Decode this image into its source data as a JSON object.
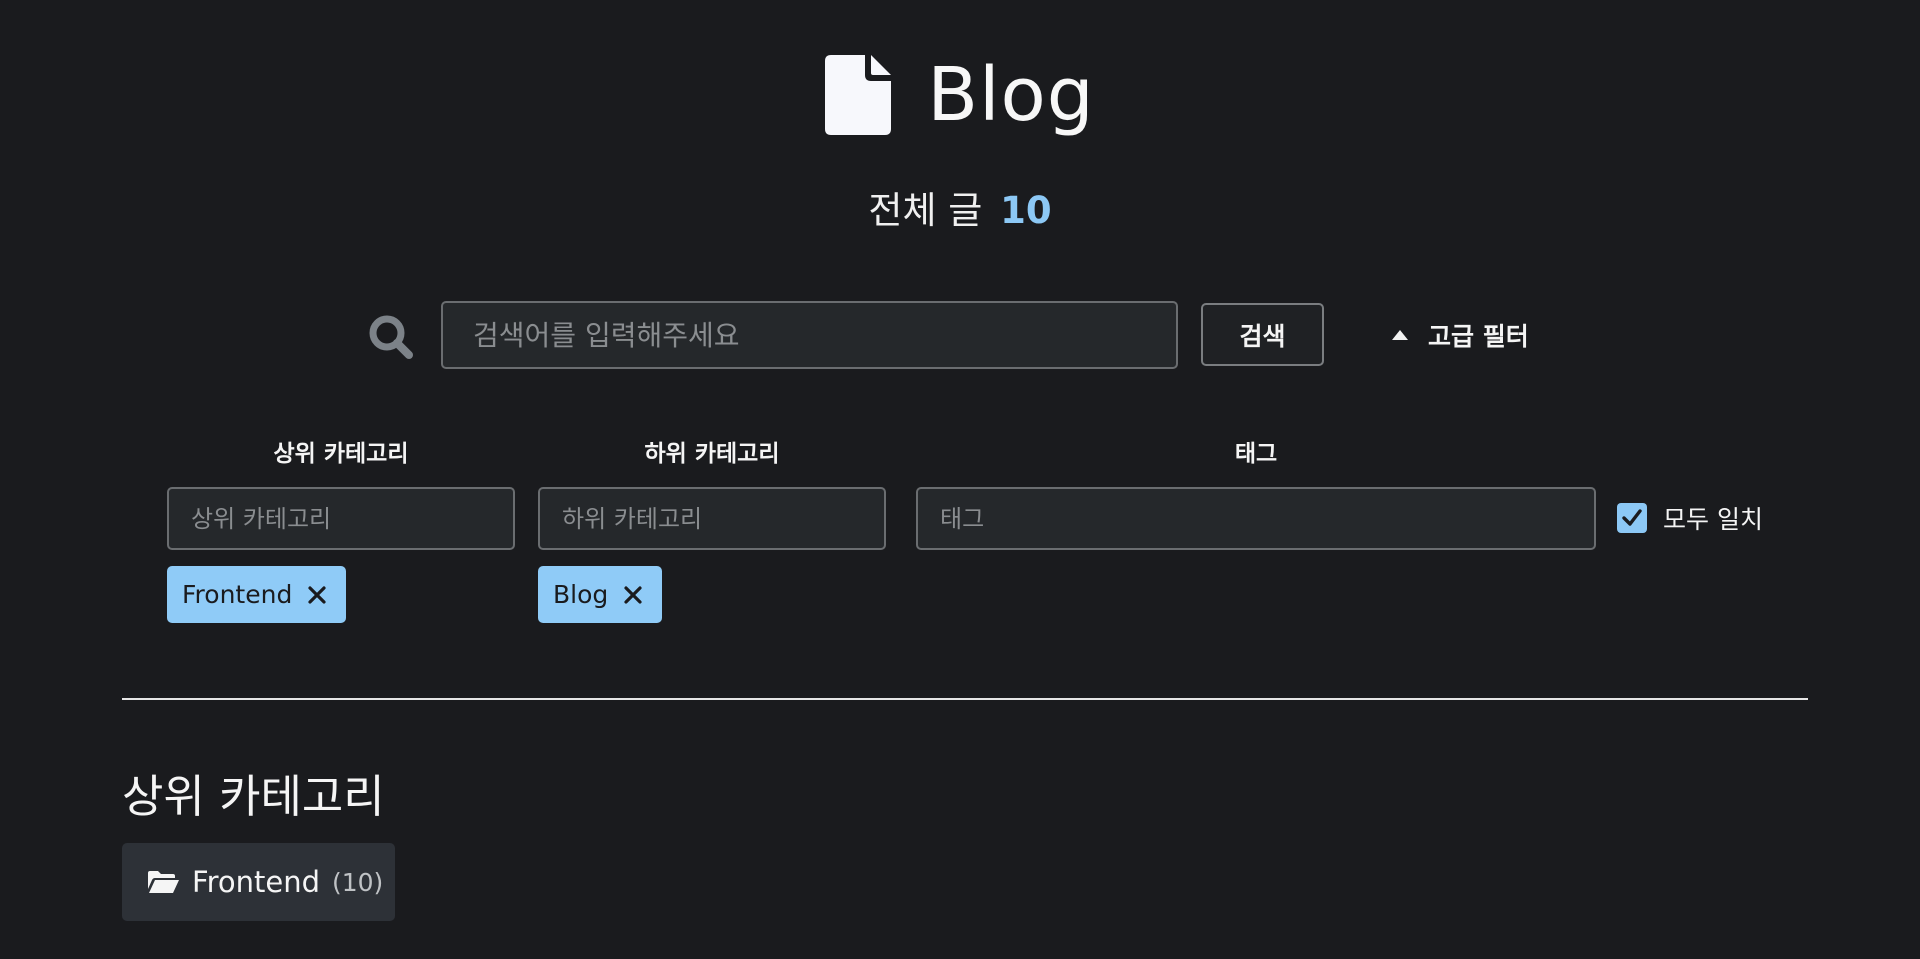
{
  "header": {
    "title": "Blog",
    "total_label": "전체 글",
    "total_count": "10",
    "icon": "document-icon"
  },
  "search": {
    "placeholder": "검색어를 입력해주세요",
    "value": "",
    "button_label": "검색",
    "advanced_label": "고급 필터",
    "advanced_expanded": true
  },
  "filters": {
    "parent_category": {
      "label": "상위 카테고리",
      "placeholder": "상위 카테고리",
      "chips": [
        "Frontend"
      ]
    },
    "child_category": {
      "label": "하위 카테고리",
      "placeholder": "하위 카테고리",
      "chips": [
        "Blog"
      ]
    },
    "tag": {
      "label": "태그",
      "placeholder": "태그",
      "chips": []
    },
    "match_all": {
      "label": "모두 일치",
      "checked": true
    }
  },
  "categories_section": {
    "title": "상위 카테고리",
    "items": [
      {
        "name": "Frontend",
        "count": "(10)"
      }
    ]
  },
  "colors": {
    "background": "#1a1b1e",
    "accent": "#8cc8f5",
    "chip": "#8fcbf7",
    "card": "#2d3137"
  }
}
